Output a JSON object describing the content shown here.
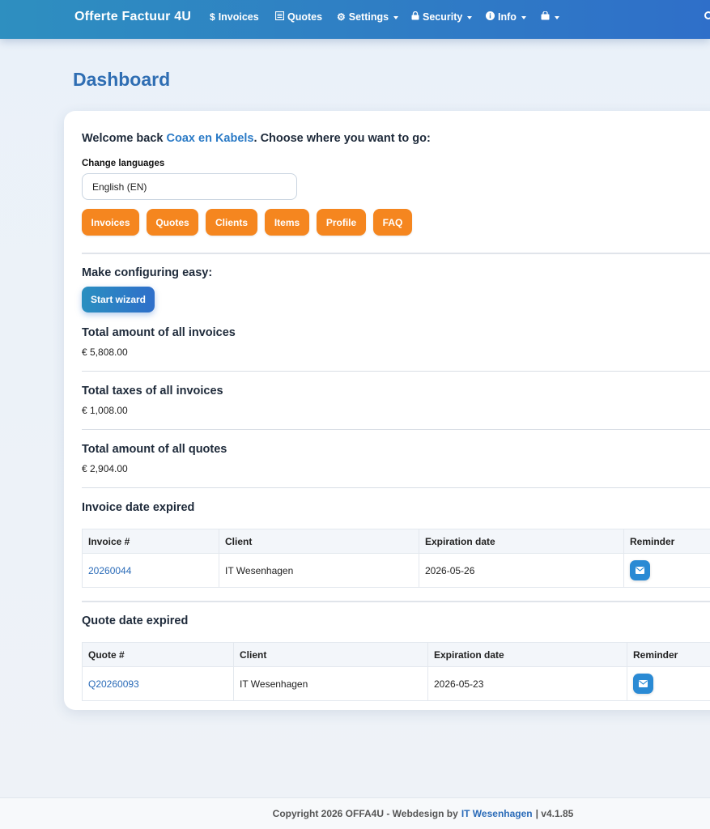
{
  "navbar": {
    "brand": "Offerte Factuur 4U",
    "items": [
      {
        "label": "Invoices",
        "icon": "dollar-icon",
        "glyph": "$"
      },
      {
        "label": "Quotes",
        "icon": "document-icon",
        "glyph": "▤"
      },
      {
        "label": "Settings",
        "icon": "gear-icon",
        "glyph": "⚙"
      },
      {
        "label": "Security",
        "icon": "lock-icon",
        "glyph": "🔒"
      },
      {
        "label": "Info",
        "icon": "info-icon",
        "glyph": "ℹ"
      }
    ]
  },
  "page": {
    "title": "Dashboard"
  },
  "welcome": {
    "prefix": "Welcome back ",
    "company": "Coax en Kabels",
    "suffix": ". Choose where you want to go:"
  },
  "language": {
    "label": "Change languages",
    "selected": "English (EN)"
  },
  "quick_links": [
    "Invoices",
    "Quotes",
    "Clients",
    "Items",
    "Profile",
    "FAQ"
  ],
  "wizard": {
    "heading": "Make configuring easy:",
    "button": "Start wizard"
  },
  "totals": {
    "invoices": {
      "label": "Total amount of all invoices",
      "value": "€ 5,808.00"
    },
    "taxes": {
      "label": "Total taxes of all invoices",
      "value": "€ 1,008.00"
    },
    "quotes": {
      "label": "Total amount of all quotes",
      "value": "€ 2,904.00"
    }
  },
  "invoice_expired": {
    "heading": "Invoice date expired",
    "columns": [
      "Invoice #",
      "Client",
      "Expiration date",
      "Reminder"
    ],
    "rows": [
      {
        "number": "20260044",
        "client": "IT Wesenhagen",
        "date": "2026-05-26"
      }
    ]
  },
  "quote_expired": {
    "heading": "Quote date expired",
    "columns": [
      "Quote #",
      "Client",
      "Expiration date",
      "Reminder"
    ],
    "rows": [
      {
        "number": "Q20260093",
        "client": "IT Wesenhagen",
        "date": "2026-05-23"
      }
    ]
  },
  "footer": {
    "prefix": "Copyright 2026 OFFA4U - Webdesign by",
    "link": "IT Wesenhagen",
    "suffix": "| v4.1.85"
  },
  "colors": {
    "accent_orange": "#f5861f",
    "brand_blue": "#2f6eb3",
    "link_blue": "#2a7ac6"
  }
}
